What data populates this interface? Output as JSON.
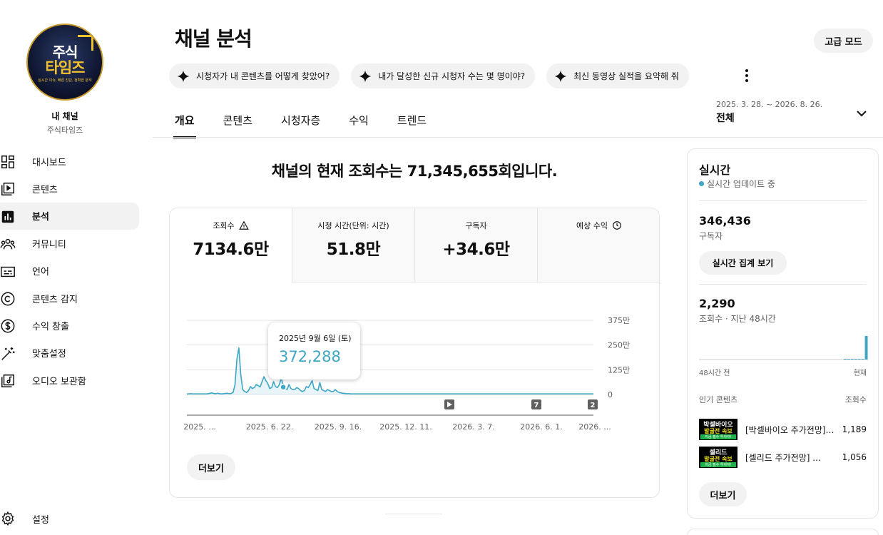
{
  "sidebar": {
    "avatar": {
      "line1": "주식",
      "line2": "타임즈",
      "line3": "실시간 이슈, 빠른 진단, 정확한 분석"
    },
    "my_channel": "내 채널",
    "channel_name": "주식타임즈",
    "items": [
      {
        "label": "대시보드",
        "icon": "dashboard-icon"
      },
      {
        "label": "콘텐츠",
        "icon": "content-icon"
      },
      {
        "label": "분석",
        "icon": "analytics-icon"
      },
      {
        "label": "커뮤니티",
        "icon": "community-icon"
      },
      {
        "label": "언어",
        "icon": "subtitles-icon"
      },
      {
        "label": "콘텐츠 감지",
        "icon": "copyright-icon"
      },
      {
        "label": "수익 창출",
        "icon": "dollar-icon"
      },
      {
        "label": "맞춤설정",
        "icon": "magic-wand-icon"
      },
      {
        "label": "오디오 보관함",
        "icon": "audio-library-icon"
      }
    ],
    "settings_label": "설정"
  },
  "header": {
    "title": "채널 분석",
    "advanced_mode": "고급 모드",
    "chips": [
      "시청자가 내 콘텐츠를 어떻게 찾았어?",
      "내가 달성한 신규 시청자 수는 몇 명이야?",
      "최신 동영상 실적을 요약해 줘"
    ],
    "tabs": [
      "개요",
      "콘텐츠",
      "시청자층",
      "수익",
      "트렌드"
    ],
    "date_range": "2025. 3. 28. ~ 2026. 8. 26.",
    "date_label": "전체"
  },
  "main": {
    "headline": "채널의 현재 조회수는 71,345,655회입니다.",
    "metrics": [
      {
        "label": "조회수",
        "value": "7134.6만",
        "icon": "warning-icon"
      },
      {
        "label": "시청 시간(단위: 시간)",
        "value": "51.8만",
        "icon": ""
      },
      {
        "label": "구독자",
        "value": "+34.6만",
        "icon": ""
      },
      {
        "label": "예상 수익",
        "value": "",
        "icon": "clock-icon"
      }
    ],
    "tooltip": {
      "date": "2025년 9월 6일 (토)",
      "value": "372,288"
    },
    "more_label": "더보기",
    "markers": [
      "",
      "7",
      "2"
    ]
  },
  "chart_data": {
    "type": "line",
    "ylim": [
      0,
      3750000
    ],
    "y_ticks": [
      "0",
      "125만",
      "250만",
      "375만"
    ],
    "x_ticks": [
      "2025. ...",
      "2025. 6. 22.",
      "2025. 9. 16.",
      "2025. 12. 11.",
      "2026. 3. 7.",
      "2026. 6. 1.",
      "2026. ..."
    ],
    "series": [
      {
        "color": "#3ea6c4",
        "values": [
          30000,
          30000,
          40000,
          30000,
          30000,
          30000,
          30000,
          30000,
          30000,
          30000,
          30000,
          40000,
          60000,
          80000,
          50000,
          40000,
          60000,
          40000,
          30000,
          40000,
          50000,
          60000,
          40000,
          50000,
          100000,
          500000,
          1800000,
          2350000,
          1000000,
          250000,
          150000,
          100000,
          200000,
          400000,
          300000,
          350000,
          500000,
          450000,
          380000,
          650000,
          900000,
          700000,
          550000,
          300000,
          350000,
          650000,
          400000,
          350000,
          500000,
          850000,
          372288,
          300000,
          250000,
          500000,
          300000,
          250000,
          250000,
          350000,
          300000,
          200000,
          150000,
          200000,
          400000,
          350000,
          500000,
          700000,
          300000,
          250000,
          200000,
          600000,
          250000,
          200000,
          150000,
          250000,
          200000,
          150000,
          150000,
          250000,
          150000,
          100000,
          80000,
          60000,
          50000,
          40000,
          40000,
          30000,
          30000,
          30000,
          30000,
          30000,
          30000,
          30000,
          30000,
          30000,
          30000,
          30000,
          30000,
          30000,
          30000,
          30000,
          30000,
          30000,
          30000,
          30000,
          30000,
          30000,
          30000,
          30000,
          30000,
          30000,
          30000,
          30000,
          30000,
          30000,
          30000,
          30000,
          30000,
          30000,
          30000,
          30000,
          30000,
          30000,
          30000,
          30000,
          30000,
          30000,
          30000,
          30000,
          30000,
          30000,
          30000,
          30000,
          30000,
          30000,
          30000,
          30000,
          30000,
          30000,
          30000,
          30000,
          30000,
          30000,
          30000,
          30000,
          30000,
          30000,
          30000,
          30000,
          30000,
          30000,
          30000,
          30000,
          30000,
          30000,
          30000,
          30000,
          30000,
          30000,
          30000,
          30000,
          30000,
          30000,
          30000,
          30000,
          30000,
          30000,
          30000,
          30000,
          30000,
          30000,
          30000,
          30000,
          30000,
          30000,
          30000,
          30000,
          30000,
          30000,
          30000,
          30000,
          30000,
          30000,
          30000,
          30000,
          30000,
          30000,
          30000,
          30000,
          30000,
          30000,
          30000,
          30000,
          30000,
          30000,
          30000,
          30000,
          30000,
          30000,
          30000,
          30000,
          30000,
          30000,
          30000,
          30000,
          30000,
          30000,
          30000,
          30000,
          30000,
          30000,
          30000,
          30000
        ]
      }
    ],
    "highlight_index": 50,
    "grid": true
  },
  "realtime": {
    "title": "실시간",
    "status": "실시간 업데이트 중",
    "subscribers": "346,436",
    "subscribers_label": "구독자",
    "view_button": "실시간 집계 보기",
    "views": "2,290",
    "views_label": "조회수 · 지난 48시간",
    "axis_left": "48시간 전",
    "axis_right": "현재",
    "bars": [
      0,
      0,
      0,
      0,
      0,
      0,
      0,
      0,
      0,
      0,
      0,
      0,
      0,
      0,
      0,
      0,
      0,
      0,
      0,
      0,
      0,
      0,
      0,
      0,
      0,
      0,
      0,
      0,
      0,
      0,
      0,
      0,
      0,
      0,
      0,
      0,
      0,
      0,
      0,
      0,
      0,
      1,
      1,
      1,
      1,
      1,
      1,
      32
    ],
    "popular_label": "인기 콘텐츠",
    "views_col": "조회수",
    "videos": [
      {
        "title": "[박셀바이오 주가전망] ...",
        "count": "1,189",
        "thumb_top": "박셀바이오",
        "thumb_mid": "발굴전 속보",
        "thumb_bot": "지금 필수 투자자!"
      },
      {
        "title": "[셀리드 주가전망] ...",
        "count": "1,056",
        "thumb_top": "셀리드",
        "thumb_mid": "발굴전 속보",
        "thumb_bot": "지금 필수 투자자!"
      }
    ],
    "more_label": "더보기"
  }
}
